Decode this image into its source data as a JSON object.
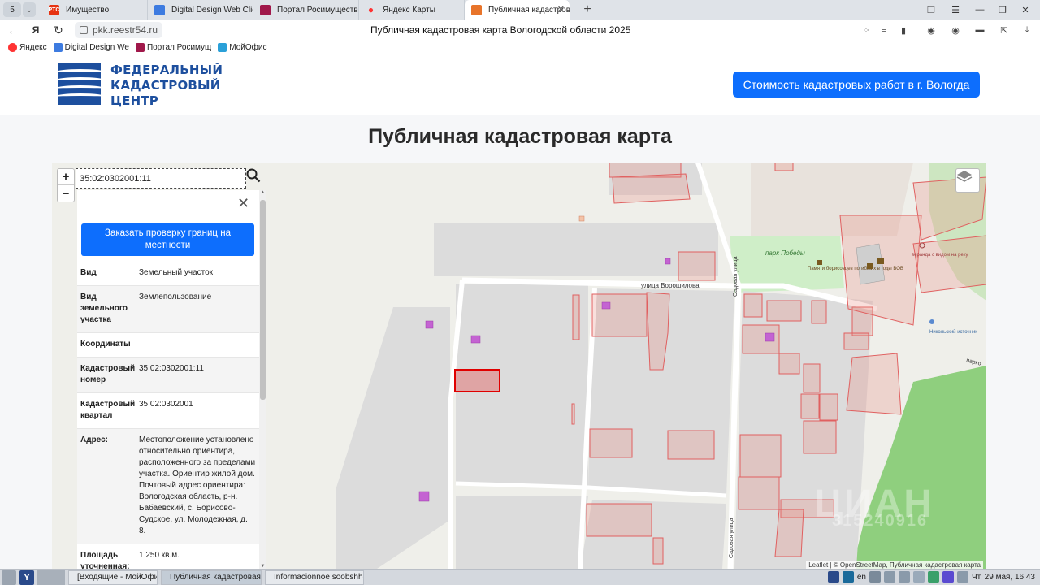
{
  "browser": {
    "tab_counter": "5",
    "tabs": [
      {
        "label": "Имущество",
        "icon": "rts-icon",
        "icon_text": "РТС",
        "icon_color": "#e63312"
      },
      {
        "label": "Digital Design Web Client",
        "icon": "digital-design-icon",
        "icon_color": "#3d7be0"
      },
      {
        "label": "Портал Росимущества",
        "icon": "rosimushchestvo-icon",
        "icon_color": "#a0184a"
      },
      {
        "label": "Яндекс Карты",
        "icon": "yandex-maps-pin-icon",
        "icon_color": "#f33"
      },
      {
        "label": "Публичная кадастров",
        "icon": "pkk-house-icon",
        "icon_color": "#e8742a",
        "active": true
      }
    ],
    "url": "pkk.reestr54.ru",
    "page_title": "Публичная кадастровая карта Вологодской области 2025",
    "bookmarks": [
      {
        "label": "Яндекс",
        "icon": "yandex-icon",
        "color": "#f33"
      },
      {
        "label": "Digital Design We",
        "icon": "digital-design-icon",
        "color": "#3d7be0"
      },
      {
        "label": "Портал Росимущ",
        "icon": "rosimushchestvo-icon",
        "color": "#a0184a"
      },
      {
        "label": "МойОфис",
        "icon": "myoffice-icon",
        "color": "#2aa0d8"
      }
    ]
  },
  "site": {
    "logo_lines": [
      "ФЕДЕРАЛЬНЫЙ",
      "КАДАСТРОВЫЙ",
      "ЦЕНТР"
    ],
    "cta_button": "Стоимость кадастровых работ в г. Вологда",
    "heading": "Публичная кадастровая карта",
    "brand_color": "#1d4f9e",
    "button_color": "#0d6efd"
  },
  "map": {
    "zoom_in": "+",
    "zoom_out": "−",
    "search_value": "35:02:0302001:11",
    "labels": {
      "street_voroshilova": "улица Ворошилова",
      "street_sadovaya_top": "Садовая улица",
      "street_sadovaya_bottom": "Садовая улица",
      "park": "парк Победы",
      "monument": "Памяти борисовцев погибших в годы ВОВ",
      "veranda": "веранда с видом на реку",
      "spring": "Никольский источник",
      "park_edge": "парко"
    },
    "attribution": "Leaflet | © OpenStreetMap, Публичная кадастровая карта",
    "watermark": "ЦИАН",
    "watermark2": "315240916",
    "highlight_color": "#e00000"
  },
  "info": {
    "order_button": "Заказать проверку границ на местности",
    "rows": [
      {
        "key": "Вид",
        "value": "Земельный участок"
      },
      {
        "key": "Вид земельного участка",
        "value": "Землепользование"
      },
      {
        "key": "Координаты",
        "value": ""
      },
      {
        "key": "Кадастровый номер",
        "value": "35:02:0302001:11"
      },
      {
        "key": "Кадастровый квартал",
        "value": "35:02:0302001"
      },
      {
        "key": "Адрес:",
        "value": "Местоположение установлено относительно ориентира, расположенного за пределами участка. Ориентир жилой дом. Почтовый адрес ориентира: Вологодская область, р-н. Бабаевский, с. Борисово-Судское, ул. Молодежная, д. 8."
      },
      {
        "key": "Площадь уточненная:",
        "value": "1 250 кв.м."
      }
    ]
  },
  "taskbar": {
    "tasks": [
      {
        "label": "[Входящие - МойОфис П...",
        "icon": "mail-folder-icon",
        "color": "#e2b23a"
      },
      {
        "label": "Публичная кадастровая ...",
        "icon": "yandex-browser-icon",
        "color": "#2a4a8a",
        "active": true
      },
      {
        "label": "Informacionnoe soobshhe...",
        "icon": "document-icon",
        "color": "#3d7be0"
      }
    ],
    "lang": "en",
    "clock": "Чт, 29 мая, 16:43"
  }
}
